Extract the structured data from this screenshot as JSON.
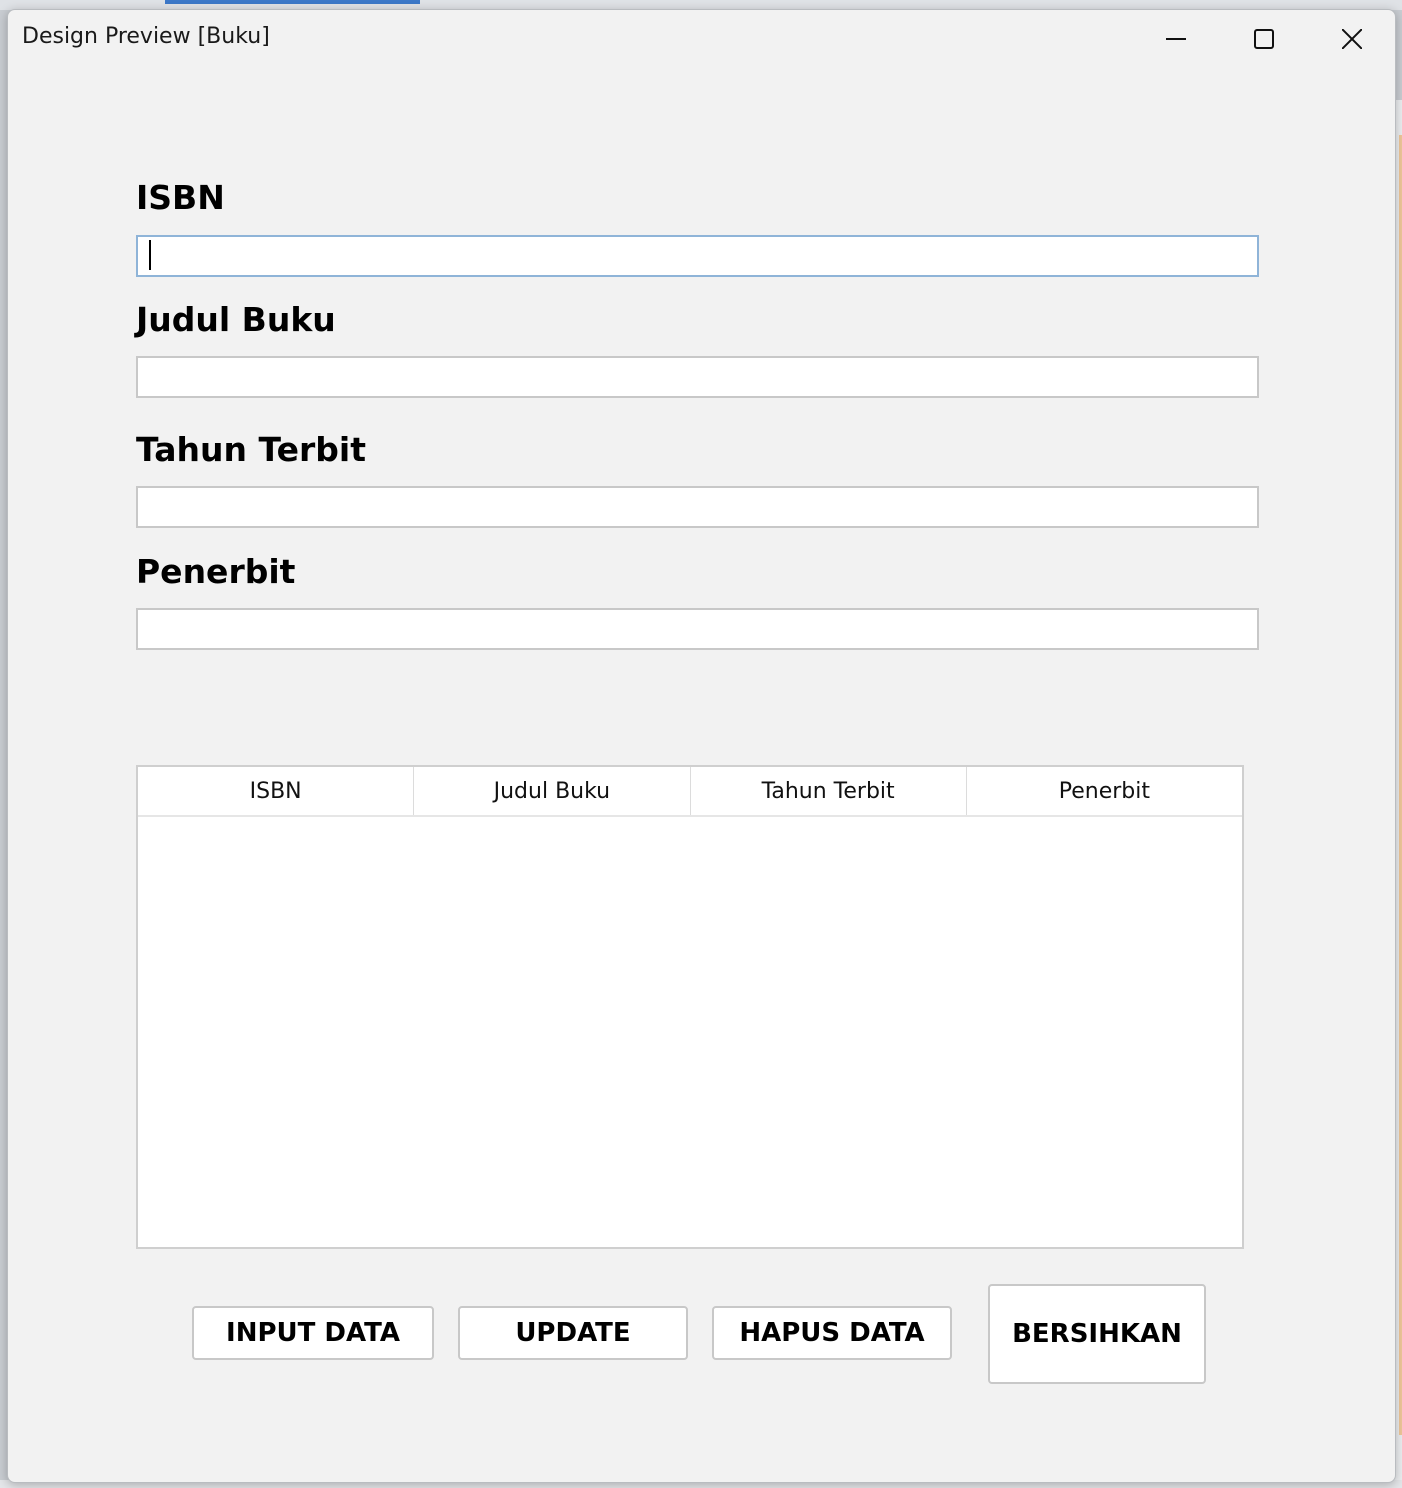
{
  "window": {
    "title": "Design Preview [Buku]"
  },
  "form": {
    "isbn_label": "ISBN",
    "judul_label": "Judul Buku",
    "tahun_label": "Tahun Terbit",
    "penerbit_label": "Penerbit",
    "isbn_value": "",
    "judul_value": "",
    "tahun_value": "",
    "penerbit_value": ""
  },
  "table": {
    "columns": [
      "ISBN",
      "Judul Buku",
      "Tahun Terbit",
      "Penerbit"
    ],
    "rows": []
  },
  "buttons": {
    "input_label": "INPUT DATA",
    "update_label": "UPDATE",
    "hapus_label": "HAPUS DATA",
    "bersihkan_label": "BERSIHKAN"
  }
}
